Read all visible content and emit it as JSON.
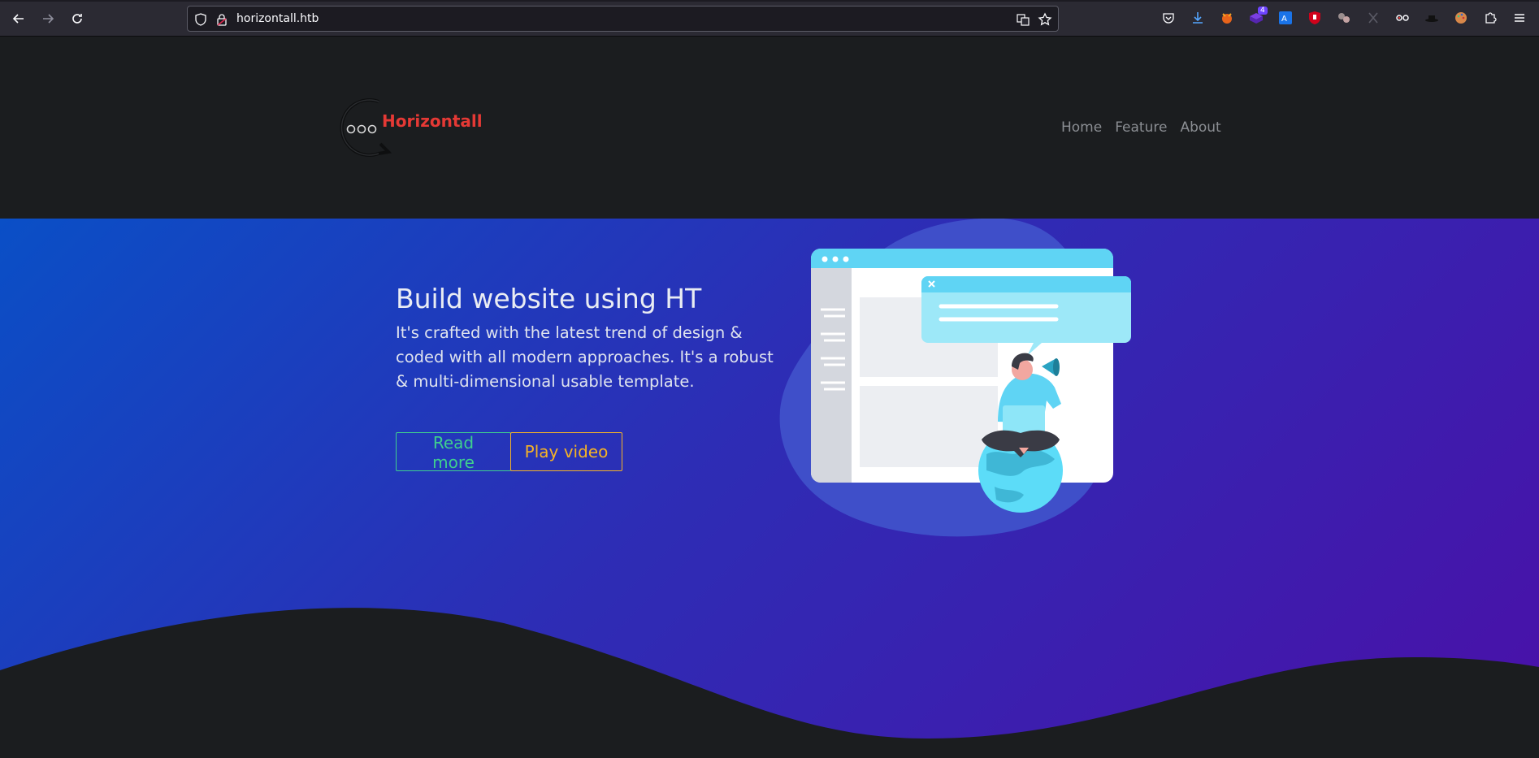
{
  "browser": {
    "url": "horizontall.htb",
    "back_icon": "arrow-left-icon",
    "forward_icon": "arrow-right-icon",
    "reload_icon": "reload-icon",
    "extension_badge": "4"
  },
  "header": {
    "brand": "Horizontall",
    "nav": [
      "Home",
      "Feature",
      "About"
    ]
  },
  "hero": {
    "title": "Build website using HT",
    "text": "It's crafted with the latest trend of design & coded with all modern approaches. It's a robust & multi-dimensional usable template.",
    "read_more": "Read more",
    "play_video": "Play video"
  },
  "colors": {
    "brand": "#e53935",
    "read_more": "#3fcf8e",
    "play_video": "#f5b326",
    "hero_start": "#0a4fc6",
    "hero_end": "#4a10a8"
  }
}
